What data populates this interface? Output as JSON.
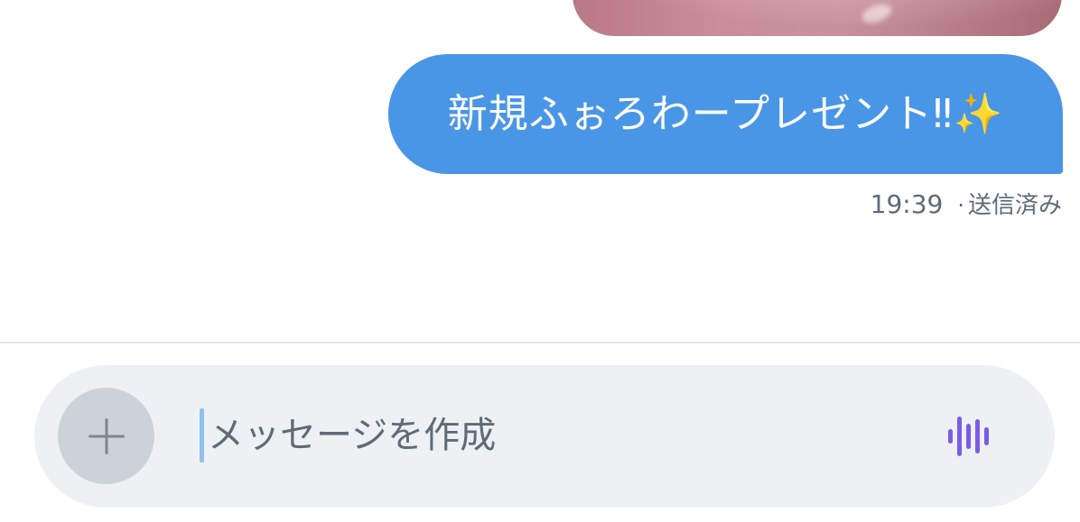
{
  "conversation": {
    "outgoing_message": {
      "text": "新規ふぉろわープレゼント‼︎✨",
      "time": "19:39",
      "separator": "·",
      "status": "送信済み"
    }
  },
  "composer": {
    "placeholder": "メッセージを作成",
    "add_icon": "plus-icon",
    "voice_icon": "voice-waveform-icon"
  },
  "colors": {
    "bubble": "#4a96e6",
    "composer_background": "#eef1f4",
    "voice_icon": "#7b5ce6",
    "add_button_background": "#cdd2d8"
  }
}
